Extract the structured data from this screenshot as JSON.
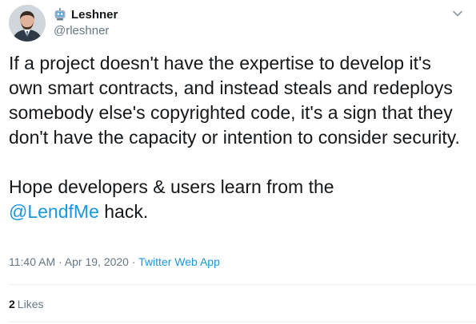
{
  "author": {
    "name": "Leshner",
    "handle": "@rleshner",
    "emoji_icon": "robot-icon"
  },
  "tweet": {
    "paragraph1": "If a project doesn't have the expertise to develop it's own smart contracts, and instead steals and redeploys somebody else's copyrighted code, it's a sign that they don't have the capacity or intention to consider security.",
    "paragraph2_text": "Hope developers & users learn from the",
    "mention": "@LendfMe",
    "paragraph2_tail": " hack."
  },
  "meta": {
    "time": "11:40 AM",
    "separator1": " · ",
    "date": "Apr 19, 2020",
    "separator2": " · ",
    "source": "Twitter Web App"
  },
  "engagement": {
    "likes_count": "2",
    "likes_label": "Likes"
  },
  "colors": {
    "link": "#1b95e0",
    "secondary_text": "#657786",
    "primary_text": "#14171a"
  }
}
